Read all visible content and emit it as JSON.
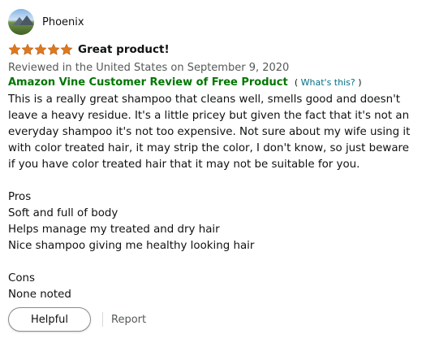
{
  "profile": {
    "name": "Phoenix"
  },
  "review": {
    "rating": 5,
    "max_rating": 5,
    "title": "Great product!",
    "date": "Reviewed in the United States on September 9, 2020",
    "vine_label": "Amazon Vine Customer Review of Free Product",
    "vine_help_open": "(",
    "vine_help_link": "What's this?",
    "vine_help_close": ")",
    "body": [
      "This is a really great shampoo that cleans well, smells good and doesn't leave a heavy residue. It's a little pricey but given the fact that it's not an everyday shampoo it's not too expensive. Not sure about my wife using it with color treated hair, it may strip the color, I don't know, so just beware if you have color treated hair that it may not be suitable for you.",
      "Pros",
      "Soft and full of body",
      "Helps manage my treated and dry hair",
      "Nice shampoo giving me healthy looking hair",
      "Cons",
      "None noted"
    ]
  },
  "actions": {
    "helpful_label": "Helpful",
    "report_label": "Report"
  },
  "colors": {
    "star": "#de7921",
    "vine_green": "#007600",
    "link": "#007185",
    "muted_text": "#565959"
  }
}
